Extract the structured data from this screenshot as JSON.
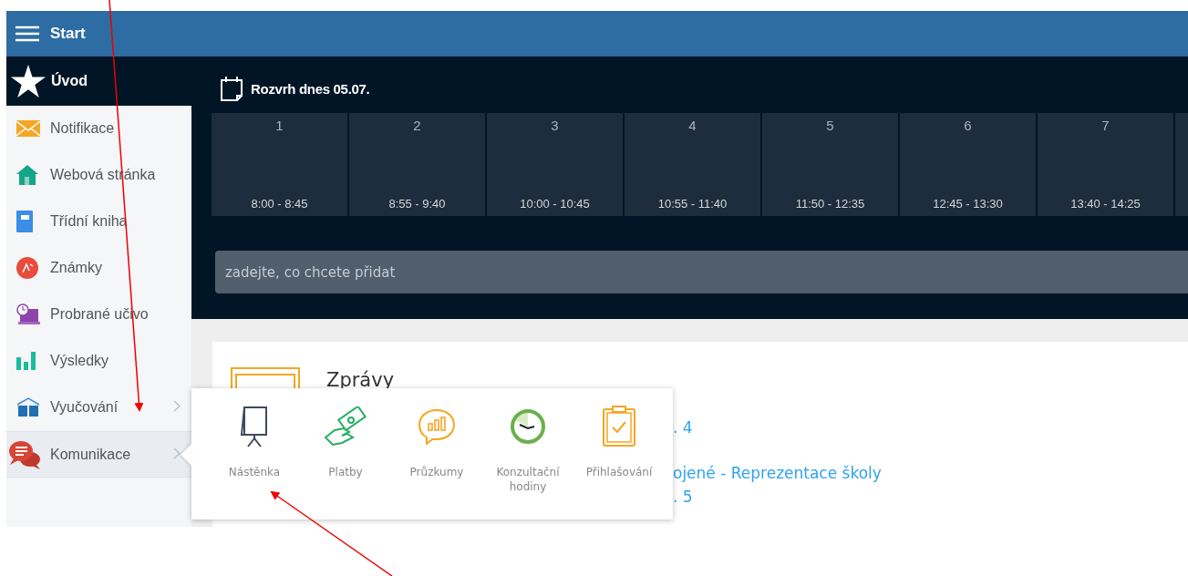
{
  "header": {
    "title": "Start"
  },
  "sidebar": {
    "home": {
      "label": "Úvod"
    },
    "items": [
      {
        "label": "Notifikace",
        "kind": "mail",
        "expandable": false,
        "selected": false
      },
      {
        "label": "Webová stránka",
        "kind": "house",
        "expandable": false,
        "selected": false
      },
      {
        "label": "Třídní kniha",
        "kind": "book",
        "expandable": false,
        "selected": false
      },
      {
        "label": "Známky",
        "kind": "grade",
        "expandable": false,
        "selected": false
      },
      {
        "label": "Probrané učivo",
        "kind": "screen",
        "expandable": false,
        "selected": false
      },
      {
        "label": "Výsledky",
        "kind": "bars",
        "expandable": false,
        "selected": false
      },
      {
        "label": "Vyučování",
        "kind": "openbook",
        "expandable": true,
        "selected": false
      },
      {
        "label": "Komunikace",
        "kind": "chat",
        "expandable": true,
        "selected": true
      }
    ]
  },
  "schedule": {
    "title": "Rozvrh dnes 05.07.",
    "periods": [
      {
        "number": "1",
        "time": "8:00 - 8:45"
      },
      {
        "number": "2",
        "time": "8:55 - 9:40"
      },
      {
        "number": "3",
        "time": "10:00 - 10:45"
      },
      {
        "number": "4",
        "time": "10:55 - 11:40"
      },
      {
        "number": "5",
        "time": "11:50 - 12:35"
      },
      {
        "number": "6",
        "time": "12:45 - 13:30"
      },
      {
        "number": "7",
        "time": "13:40 - 14:25"
      }
    ]
  },
  "add_field": {
    "placeholder": "zadejte, co chcete přidat"
  },
  "messages": {
    "title": "Zprávy",
    "lines": [
      ". 4",
      "ojené - Reprezentace školy",
      ". 5"
    ]
  },
  "submenu": {
    "items": [
      {
        "label": "Nástěnka",
        "kind": "board"
      },
      {
        "label": "Platby",
        "kind": "money"
      },
      {
        "label": "Průzkumy",
        "kind": "poll"
      },
      {
        "label": "Konzultační hodiny",
        "kind": "clock"
      },
      {
        "label": "Přihlašování",
        "kind": "clipboard"
      }
    ]
  }
}
